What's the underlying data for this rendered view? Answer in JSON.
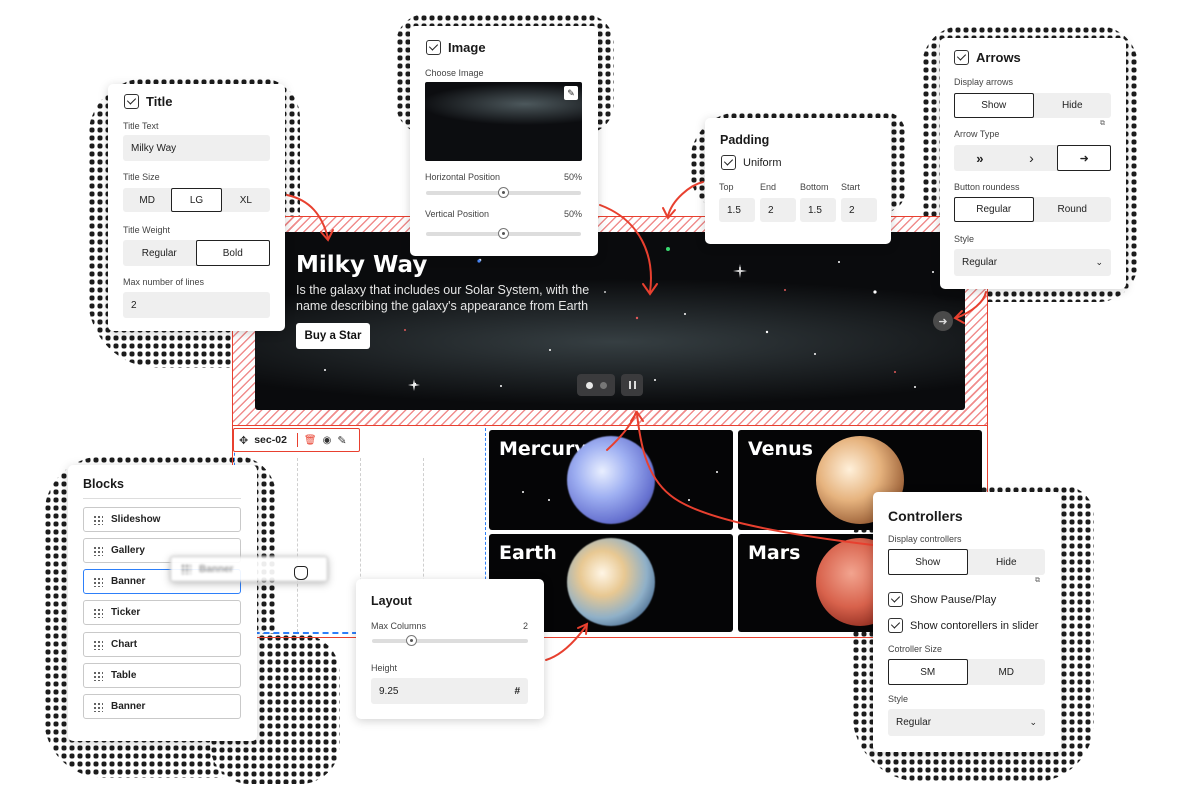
{
  "colors": {
    "accent_red": "#e8402f",
    "selection_blue": "#2d7ff9",
    "panel_bg": "#ffffff",
    "field_bg": "#efefef"
  },
  "title_panel": {
    "heading": "Title",
    "title_text_label": "Title Text",
    "title_text_value": "Milky Way",
    "title_size_label": "Title Size",
    "sizes": [
      "MD",
      "LG",
      "XL"
    ],
    "size_selected": "LG",
    "weight_label": "Title Weight",
    "weights": [
      "Regular",
      "Bold"
    ],
    "weight_selected": "Bold",
    "max_lines_label": "Max number of lines",
    "max_lines_value": "2"
  },
  "image_panel": {
    "heading": "Image",
    "choose_label": "Choose Image",
    "h_pos_label": "Horizontal Position",
    "h_pos_value": "50%",
    "h_pos_fraction": 0.5,
    "v_pos_label": "Vertical Position",
    "v_pos_value": "50%",
    "v_pos_fraction": 0.5
  },
  "padding_panel": {
    "heading": "Padding",
    "uniform_label": "Uniform",
    "top_label": "Top",
    "top_value": "1.5",
    "end_label": "End",
    "end_value": "2",
    "bottom_label": "Bottom",
    "bottom_value": "1.5",
    "start_label": "Start",
    "start_value": "2"
  },
  "arrows_panel": {
    "heading": "Arrows",
    "display_label": "Display arrows",
    "display_options": [
      "Show",
      "Hide"
    ],
    "display_selected": "Show",
    "arrow_type_label": "Arrow Type",
    "arrow_types": [
      "»",
      "›",
      "➜"
    ],
    "arrow_selected": "➜",
    "roundness_label": "Button roundess",
    "roundness_options": [
      "Regular",
      "Round"
    ],
    "roundness_selected": "Regular",
    "style_label": "Style",
    "style_value": "Regular"
  },
  "hero": {
    "title": "Milky Way",
    "description": "Is the galaxy that includes our Solar System, with the name describing the galaxy's appearance from Earth",
    "cta": "Buy a Star"
  },
  "section": {
    "label": "sec-02"
  },
  "planets": [
    {
      "name": "Mercury"
    },
    {
      "name": "Venus"
    },
    {
      "name": "Earth"
    },
    {
      "name": "Mars"
    }
  ],
  "blocks_panel": {
    "heading": "Blocks",
    "items": [
      "Slideshow",
      "Gallery",
      "Banner",
      "Ticker",
      "Chart",
      "Table",
      "Banner"
    ],
    "dragging": "Banner"
  },
  "layout_panel": {
    "heading": "Layout",
    "max_columns_label": "Max Columns",
    "max_columns_value": "2",
    "max_columns_fraction": 0.25,
    "height_label": "Height",
    "height_value": "9.25",
    "height_unit": "#"
  },
  "controllers_panel": {
    "heading": "Controllers",
    "display_label": "Display controllers",
    "display_options": [
      "Show",
      "Hide"
    ],
    "display_selected": "Show",
    "show_pause_label": "Show Pause/Play",
    "show_slider_label": "Show contorellers in slider",
    "size_label": "Cotroller Size",
    "sizes": [
      "SM",
      "MD"
    ],
    "size_selected": "SM",
    "style_label": "Style",
    "style_value": "Regular"
  }
}
